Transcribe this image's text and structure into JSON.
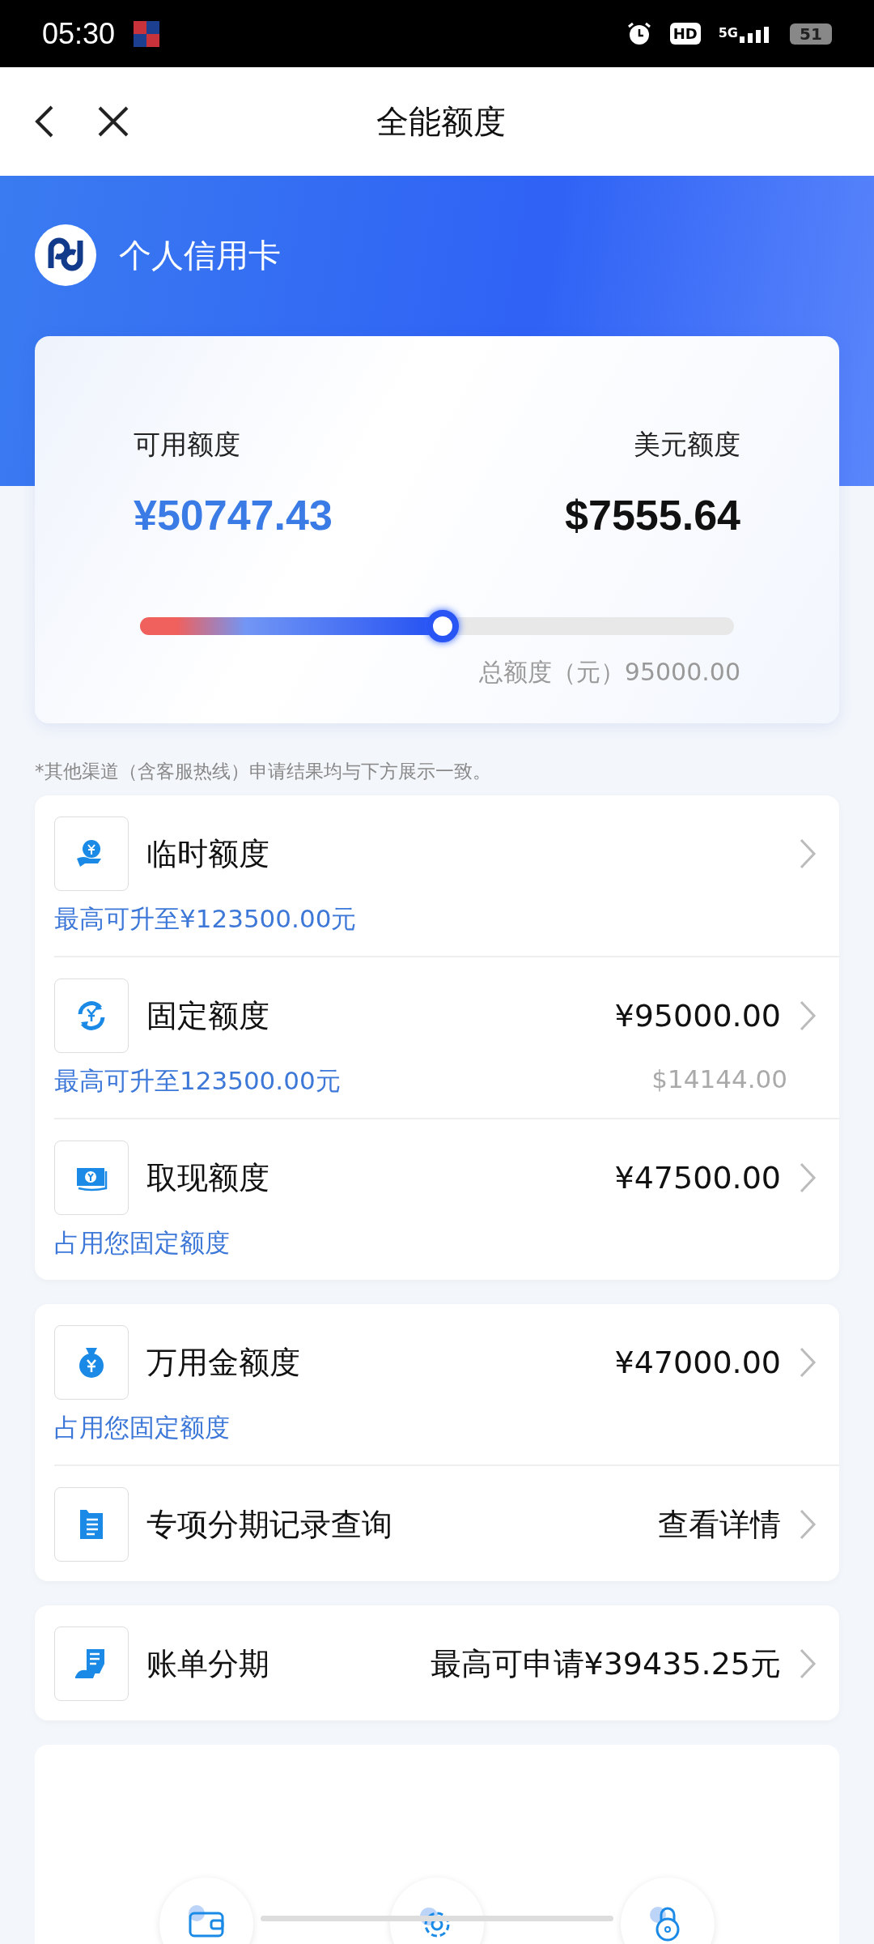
{
  "status_bar": {
    "time": "05:30",
    "hd": "HD",
    "network": "5G",
    "battery": "51"
  },
  "nav": {
    "title": "全能额度"
  },
  "header": {
    "card_name": "个人信用卡"
  },
  "summary": {
    "available_label": "可用额度",
    "available": "¥50747.43",
    "usd_label": "美元额度",
    "usd": "$7555.64",
    "level": 0.51,
    "total": "总额度（元）95000.00"
  },
  "note": "*其他渠道（含客服热线）申请结果均与下方展示一致。",
  "groups": [
    {
      "rows": [
        {
          "title": "临时额度",
          "sub": "最高可升至¥123500.00元"
        },
        {
          "title": "固定额度",
          "value": "¥95000.00",
          "sub": "最高可升至123500.00元",
          "sub_right": "$14144.00"
        },
        {
          "title": "取现额度",
          "value": "¥47500.00",
          "sub": "占用您固定额度"
        }
      ]
    },
    {
      "rows": [
        {
          "title": "万用金额度",
          "value": "¥47000.00",
          "sub": "占用您固定额度"
        },
        {
          "title": "专项分期记录查询",
          "value": "查看详情"
        }
      ]
    },
    {
      "rows": [
        {
          "title": "账单分期",
          "value": "最高可申请¥39435.25元"
        }
      ]
    }
  ]
}
